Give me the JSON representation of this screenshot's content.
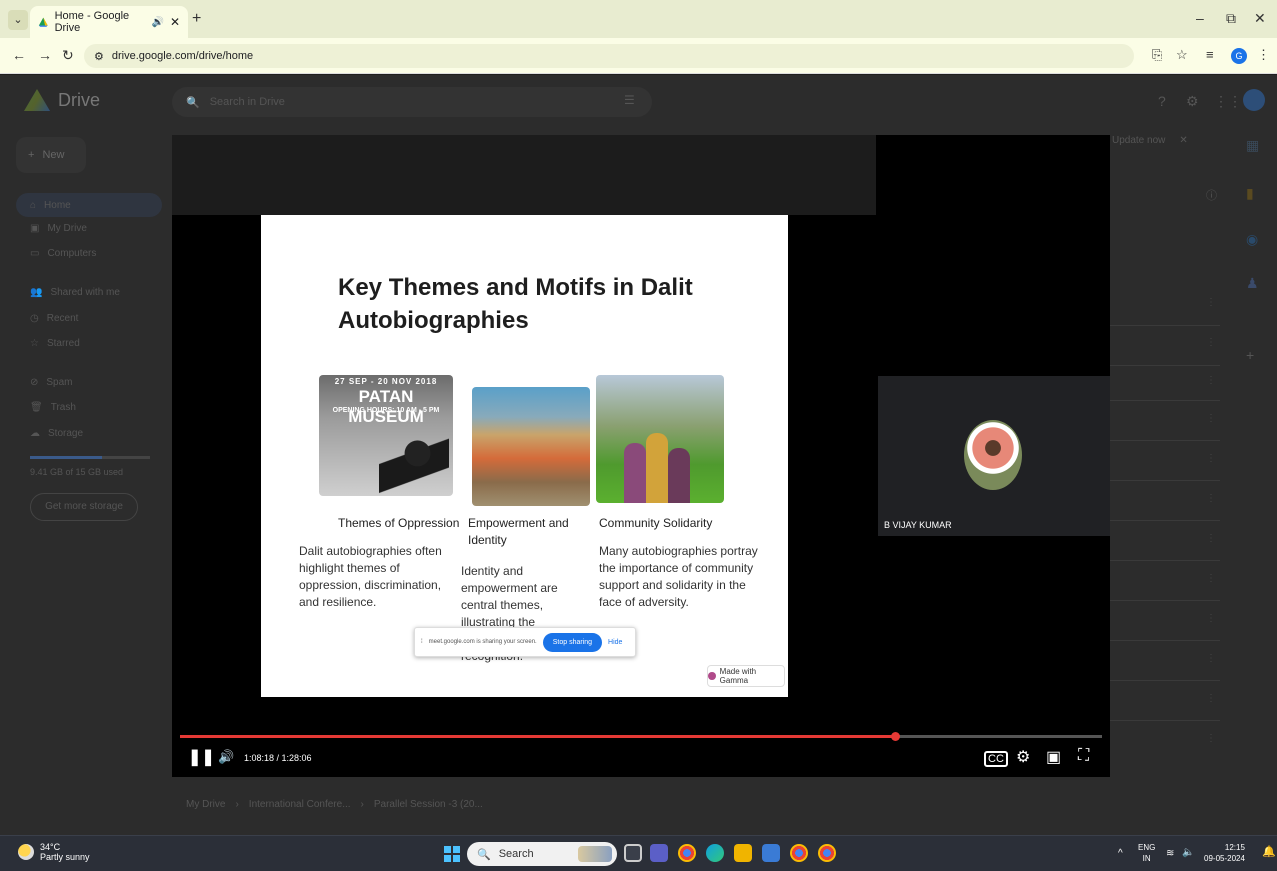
{
  "browser": {
    "tab_title": "Home - Google Drive",
    "url": "drive.google.com/drive/home",
    "profile_initial": "G"
  },
  "drive": {
    "app_name": "Drive",
    "search_placeholder": "Search in Drive",
    "new_label": "New",
    "nav": [
      {
        "label": "Home",
        "icon": "home-icon"
      },
      {
        "label": "My Drive",
        "icon": "my-drive-icon"
      },
      {
        "label": "Computers",
        "icon": "computer-icon"
      },
      {
        "label": "Shared with me",
        "icon": "people-icon"
      },
      {
        "label": "Recent",
        "icon": "clock-icon"
      },
      {
        "label": "Starred",
        "icon": "star-icon"
      },
      {
        "label": "Spam",
        "icon": "spam-icon"
      },
      {
        "label": "Trash",
        "icon": "trash-icon"
      },
      {
        "label": "Storage",
        "icon": "cloud-icon"
      }
    ],
    "storage_text": "9.41 GB of 15 GB used",
    "get_storage_label": "Get more storage",
    "update_text": "Update now",
    "breadcrumb": [
      "My Drive",
      "International Confere...",
      "Parallel Session -3 (20..."
    ]
  },
  "player": {
    "time_display": "1:08:18 / 1:28:06",
    "progress": 0.775
  },
  "slide": {
    "title": "Key Themes and Motifs in Dalit Autobiographies",
    "poster": {
      "dates": "27 SEP - 20 NOV 2018",
      "name": "PATAN MUSEUM",
      "hours": "OPENING HOURS: 10 AM - 5 PM"
    },
    "columns": [
      {
        "heading": "Themes of Oppression",
        "body": "Dalit autobiographies often highlight themes of oppression, discrimination, and resilience."
      },
      {
        "heading": "Empowerment and Identity",
        "body": "Identity and empowerment are central themes, illustrating the struggle ... recognition."
      },
      {
        "heading": "Community Solidarity",
        "body": "Many autobiographies portray the importance of community support and solidarity in the face of adversity."
      }
    ],
    "badge": "Made with Gamma"
  },
  "share_bar": {
    "message": "meet.google.com is sharing your screen.",
    "stop_label": "Stop sharing",
    "hide_label": "Hide"
  },
  "participant": {
    "name": "B VIJAY KUMAR"
  },
  "taskbar": {
    "temperature": "34°C",
    "weather": "Partly sunny",
    "search_label": "Search",
    "lang": "ENG",
    "region": "IN",
    "time": "12:15",
    "date": "09-05-2024"
  }
}
